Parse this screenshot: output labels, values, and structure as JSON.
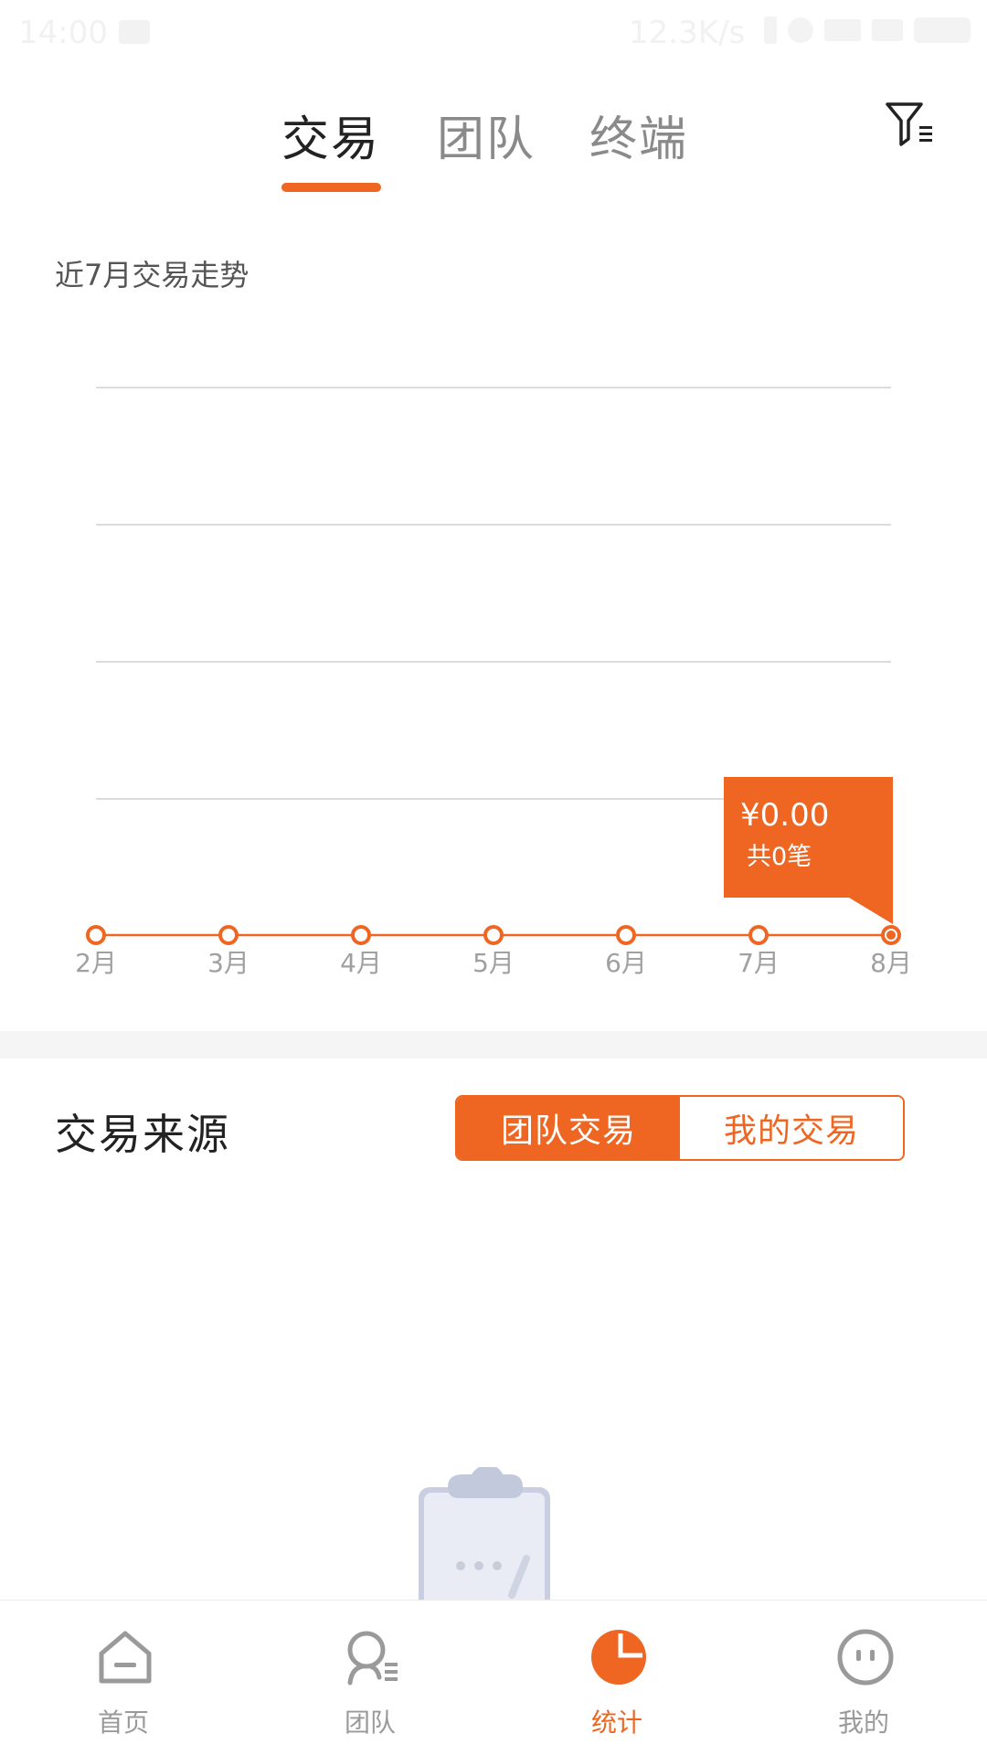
{
  "status_bar": {
    "time": "14:00",
    "speed": "12.3K/s"
  },
  "top_tabs": [
    {
      "label": "交易",
      "active": true
    },
    {
      "label": "团队",
      "active": false
    },
    {
      "label": "终端",
      "active": false
    }
  ],
  "filter_icon": "filter-list-icon",
  "chart_title": "近7月交易走势",
  "chart_data": {
    "type": "line",
    "categories": [
      "2月",
      "3月",
      "4月",
      "5月",
      "6月",
      "7月",
      "8月"
    ],
    "series": [
      {
        "values": [
          0,
          0,
          0,
          0,
          0,
          0,
          0
        ]
      }
    ],
    "grid": true,
    "tooltip": {
      "category": "8月",
      "amount": "¥0.00",
      "count": "共0笔"
    },
    "color": "#ee6622"
  },
  "source": {
    "title": "交易来源",
    "segments": [
      {
        "label": "团队交易",
        "active": true
      },
      {
        "label": "我的交易",
        "active": false
      }
    ]
  },
  "bottom_nav": [
    {
      "label": "首页",
      "icon": "home-icon",
      "active": false
    },
    {
      "label": "团队",
      "icon": "team-icon",
      "active": false
    },
    {
      "label": "统计",
      "icon": "pie-chart-icon",
      "active": true
    },
    {
      "label": "我的",
      "icon": "face-icon",
      "active": false
    }
  ],
  "colors": {
    "accent": "#ee6622",
    "inactive": "#9a9a9a"
  }
}
